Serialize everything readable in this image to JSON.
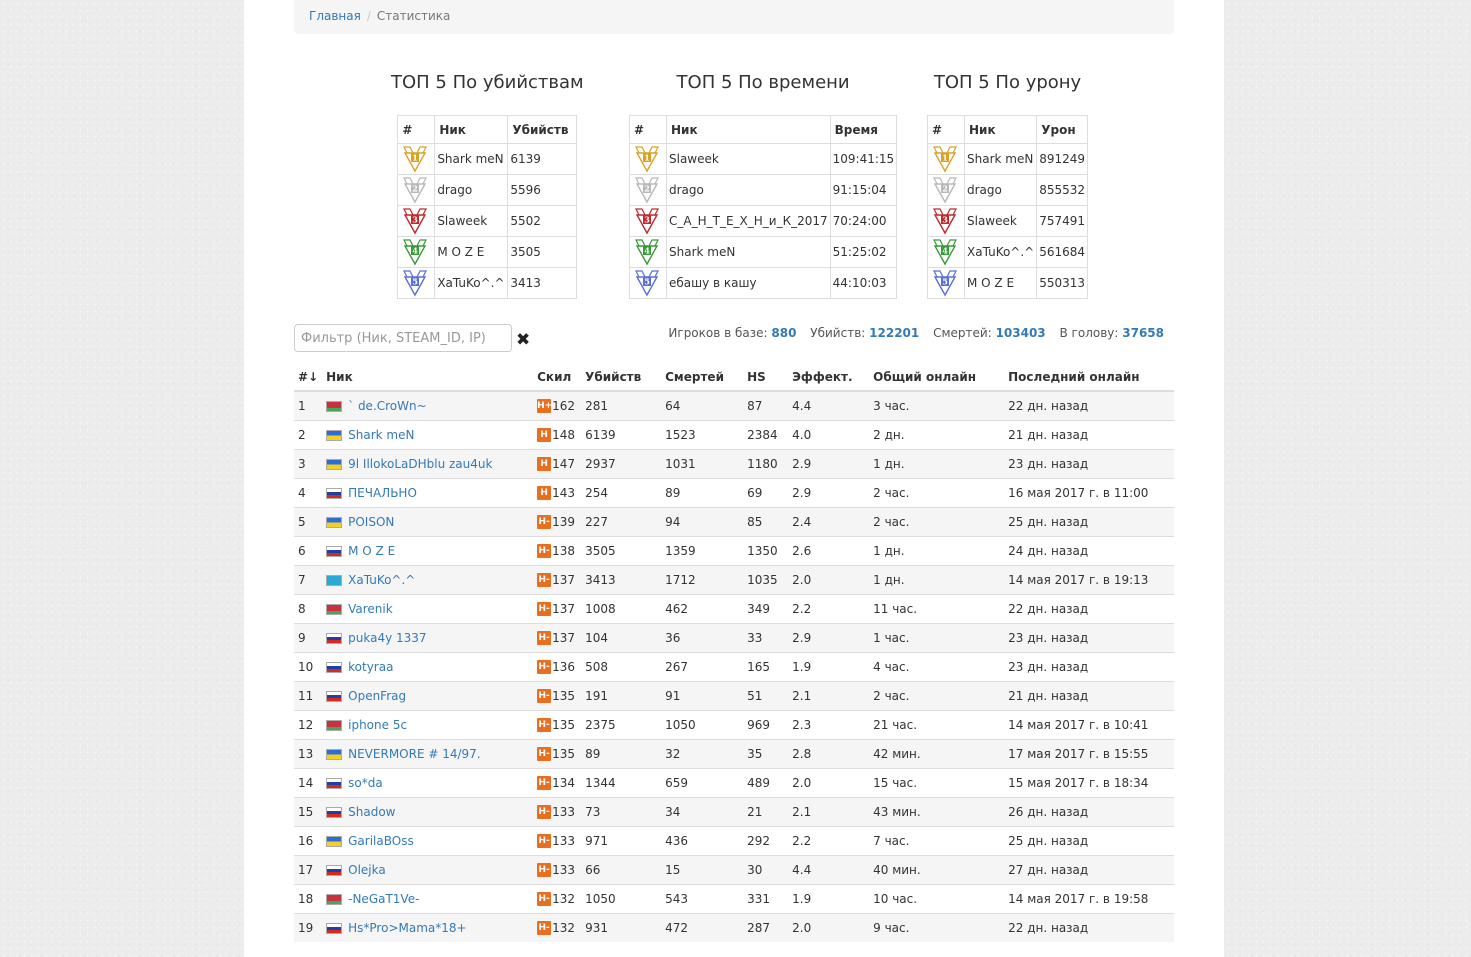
{
  "breadcrumb": {
    "home": "Главная",
    "separator": "/",
    "current": "Статистика"
  },
  "top_kills": {
    "title": "ТОП 5 По убийствам",
    "headers": [
      "#",
      "Ник",
      "Убийств"
    ],
    "rows": [
      {
        "rank": "1",
        "nick": "Shark meN",
        "value": "6139",
        "color": "#d9a227"
      },
      {
        "rank": "2",
        "nick": "drago",
        "value": "5596",
        "color": "#b8b8b8"
      },
      {
        "rank": "3",
        "nick": "Slaweek",
        "value": "5502",
        "color": "#c0282d"
      },
      {
        "rank": "4",
        "nick": "M O Z E",
        "value": "3505",
        "color": "#3a9a3a"
      },
      {
        "rank": "5",
        "nick": "XaTuKo^.^",
        "value": "3413",
        "color": "#5a6ed9"
      }
    ]
  },
  "top_time": {
    "title": "ТОП 5 По времени",
    "headers": [
      "#",
      "Ник",
      "Время"
    ],
    "rows": [
      {
        "rank": "1",
        "nick": "Slaweek",
        "value": "109:41:15",
        "color": "#d9a227"
      },
      {
        "rank": "2",
        "nick": "drago",
        "value": "91:15:04",
        "color": "#b8b8b8"
      },
      {
        "rank": "3",
        "nick": "С_А_Н_Т_Е_Х_Н_и_К_2017",
        "value": "70:24:00",
        "color": "#c0282d"
      },
      {
        "rank": "4",
        "nick": "Shark meN",
        "value": "51:25:02",
        "color": "#3a9a3a"
      },
      {
        "rank": "5",
        "nick": "ебашу в кашу",
        "value": "44:10:03",
        "color": "#5a6ed9"
      }
    ]
  },
  "top_damage": {
    "title": "ТОП 5 По урону",
    "headers": [
      "#",
      "Ник",
      "Урон"
    ],
    "rows": [
      {
        "rank": "1",
        "nick": "Shark meN",
        "value": "891249",
        "color": "#d9a227"
      },
      {
        "rank": "2",
        "nick": "drago",
        "value": "855532",
        "color": "#b8b8b8"
      },
      {
        "rank": "3",
        "nick": "Slaweek",
        "value": "757491",
        "color": "#c0282d"
      },
      {
        "rank": "4",
        "nick": "XaTuKo^.^",
        "value": "561684",
        "color": "#3a9a3a"
      },
      {
        "rank": "5",
        "nick": "M O Z E",
        "value": "550313",
        "color": "#5a6ed9"
      }
    ]
  },
  "filter": {
    "placeholder": "Фильтр (Ник, STEAM_ID, IP)",
    "clear_icon": "close-icon"
  },
  "stats": {
    "players_label": "Игроков в базе:",
    "players": "880",
    "kills_label": "Убийств:",
    "kills": "122201",
    "deaths_label": "Смертей:",
    "deaths": "103403",
    "hs_label": "В голову:",
    "hs": "37658"
  },
  "table": {
    "headers": {
      "rank": "#",
      "sort_icon": "↓",
      "nick": "Ник",
      "skill": "Скил",
      "kills": "Убийств",
      "deaths": "Смертей",
      "hs": "HS",
      "eff": "Эффект.",
      "online": "Общий онлайн",
      "last": "Последний онлайн"
    },
    "flag_colors": {
      "by": [
        "#c8313e",
        "#4aa657"
      ],
      "ua": [
        "#2b6fd6",
        "#f5d020"
      ],
      "ru": [
        "#ffffff",
        "#1c3fa8",
        "#d52b1e"
      ],
      "kz": [
        "#28a9d6",
        "#28a9d6"
      ]
    },
    "rows": [
      {
        "rank": "1",
        "flag": "by",
        "nick": "` de.CroWn~",
        "skill_badge": "H+",
        "skill": "162",
        "kills": "281",
        "deaths": "64",
        "hs": "87",
        "eff": "4.4",
        "online": "3 час.",
        "last": "22 дн. назад"
      },
      {
        "rank": "2",
        "flag": "ua",
        "nick": "Shark meN",
        "skill_badge": "H",
        "skill": "148",
        "kills": "6139",
        "deaths": "1523",
        "hs": "2384",
        "eff": "4.0",
        "online": "2 дн.",
        "last": "21 дн. назад"
      },
      {
        "rank": "3",
        "flag": "ua",
        "nick": "9l IllokoLaDHblu zau4uk",
        "skill_badge": "H",
        "skill": "147",
        "kills": "2937",
        "deaths": "1031",
        "hs": "1180",
        "eff": "2.9",
        "online": "1 дн.",
        "last": "23 дн. назад"
      },
      {
        "rank": "4",
        "flag": "ru",
        "nick": "ПЕЧАЛЬНО",
        "skill_badge": "H",
        "skill": "143",
        "kills": "254",
        "deaths": "89",
        "hs": "69",
        "eff": "2.9",
        "online": "2 час.",
        "last": "16 мая 2017 г. в 11:00"
      },
      {
        "rank": "5",
        "flag": "ua",
        "nick": "POISON",
        "skill_badge": "H-",
        "skill": "139",
        "kills": "227",
        "deaths": "94",
        "hs": "85",
        "eff": "2.4",
        "online": "2 час.",
        "last": "25 дн. назад"
      },
      {
        "rank": "6",
        "flag": "ru",
        "nick": "M O Z E",
        "skill_badge": "H-",
        "skill": "138",
        "kills": "3505",
        "deaths": "1359",
        "hs": "1350",
        "eff": "2.6",
        "online": "1 дн.",
        "last": "24 дн. назад"
      },
      {
        "rank": "7",
        "flag": "kz",
        "nick": "XaTuKo^.^",
        "skill_badge": "H-",
        "skill": "137",
        "kills": "3413",
        "deaths": "1712",
        "hs": "1035",
        "eff": "2.0",
        "online": "1 дн.",
        "last": "14 мая 2017 г. в 19:13"
      },
      {
        "rank": "8",
        "flag": "by",
        "nick": "Varenik",
        "skill_badge": "H-",
        "skill": "137",
        "kills": "1008",
        "deaths": "462",
        "hs": "349",
        "eff": "2.2",
        "online": "11 час.",
        "last": "22 дн. назад"
      },
      {
        "rank": "9",
        "flag": "ru",
        "nick": "puka4y 1337",
        "skill_badge": "H-",
        "skill": "137",
        "kills": "104",
        "deaths": "36",
        "hs": "33",
        "eff": "2.9",
        "online": "1 час.",
        "last": "23 дн. назад"
      },
      {
        "rank": "10",
        "flag": "ru",
        "nick": "kotyraa",
        "skill_badge": "H-",
        "skill": "136",
        "kills": "508",
        "deaths": "267",
        "hs": "165",
        "eff": "1.9",
        "online": "4 час.",
        "last": "23 дн. назад"
      },
      {
        "rank": "11",
        "flag": "ru",
        "nick": "OpenFrag",
        "skill_badge": "H-",
        "skill": "135",
        "kills": "191",
        "deaths": "91",
        "hs": "51",
        "eff": "2.1",
        "online": "2 час.",
        "last": "21 дн. назад"
      },
      {
        "rank": "12",
        "flag": "by",
        "nick": "iphone 5c",
        "skill_badge": "H-",
        "skill": "135",
        "kills": "2375",
        "deaths": "1050",
        "hs": "969",
        "eff": "2.3",
        "online": "21 час.",
        "last": "14 мая 2017 г. в 10:41"
      },
      {
        "rank": "13",
        "flag": "ua",
        "nick": "NEVERMORE # 14/97.",
        "skill_badge": "H-",
        "skill": "135",
        "kills": "89",
        "deaths": "32",
        "hs": "35",
        "eff": "2.8",
        "online": "42 мин.",
        "last": "17 мая 2017 г. в 15:55"
      },
      {
        "rank": "14",
        "flag": "ru",
        "nick": "so*da",
        "skill_badge": "H-",
        "skill": "134",
        "kills": "1344",
        "deaths": "659",
        "hs": "489",
        "eff": "2.0",
        "online": "15 час.",
        "last": "15 мая 2017 г. в 18:34"
      },
      {
        "rank": "15",
        "flag": "ru",
        "nick": "Shadow",
        "skill_badge": "H-",
        "skill": "133",
        "kills": "73",
        "deaths": "34",
        "hs": "21",
        "eff": "2.1",
        "online": "43 мин.",
        "last": "26 дн. назад"
      },
      {
        "rank": "16",
        "flag": "ua",
        "nick": "GarilaBOss",
        "skill_badge": "H-",
        "skill": "133",
        "kills": "971",
        "deaths": "436",
        "hs": "292",
        "eff": "2.2",
        "online": "7 час.",
        "last": "25 дн. назад"
      },
      {
        "rank": "17",
        "flag": "ru",
        "nick": "Olejka",
        "skill_badge": "H-",
        "skill": "133",
        "kills": "66",
        "deaths": "15",
        "hs": "30",
        "eff": "4.4",
        "online": "40 мин.",
        "last": "27 дн. назад"
      },
      {
        "rank": "18",
        "flag": "by",
        "nick": "-NeGaT1Ve-",
        "skill_badge": "H-",
        "skill": "132",
        "kills": "1050",
        "deaths": "543",
        "hs": "331",
        "eff": "1.9",
        "online": "10 час.",
        "last": "14 мая 2017 г. в 19:58"
      },
      {
        "rank": "19",
        "flag": "ru",
        "nick": "Hs*Pro>Mama*18+",
        "skill_badge": "H-",
        "skill": "132",
        "kills": "931",
        "deaths": "472",
        "hs": "287",
        "eff": "2.0",
        "online": "9 час.",
        "last": "22 дн. назад"
      }
    ]
  }
}
